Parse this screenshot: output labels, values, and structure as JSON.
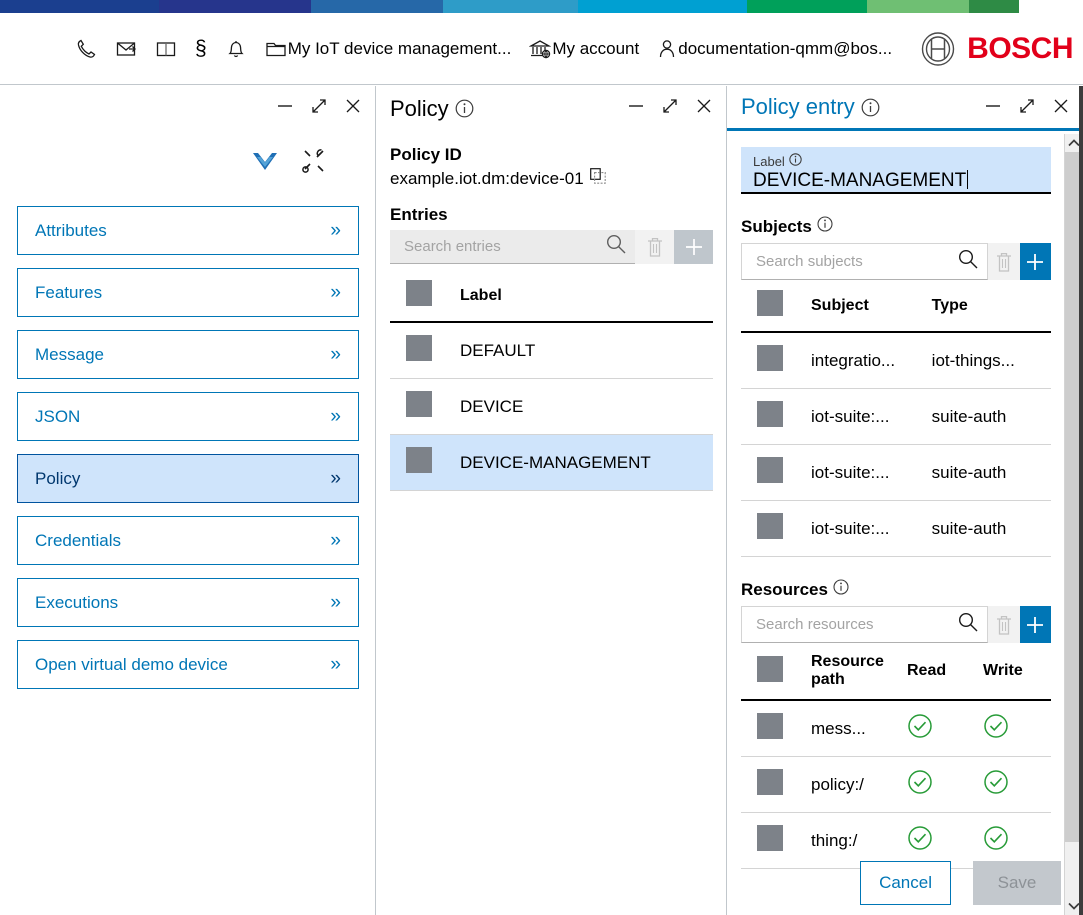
{
  "supergraphic": {
    "colors": [
      "#1b3f8f",
      "#26358c",
      "#2668a8",
      "#2e9cc8",
      "#00a0d2",
      "#00a05a",
      "#6fbf73",
      "#2e8b45"
    ]
  },
  "header": {
    "items": [
      {
        "icon": "phone-icon",
        "glyph": "✆",
        "label": ""
      },
      {
        "icon": "mail-icon",
        "glyph": "✉",
        "label": ""
      },
      {
        "icon": "book-icon",
        "glyph": "ὖE",
        "label": ""
      },
      {
        "icon": "section-sign-icon",
        "glyph": "§",
        "label": ""
      },
      {
        "icon": "bell-icon",
        "glyph": "ὑ4",
        "label": ""
      },
      {
        "icon": "folder-icon",
        "glyph": "folder",
        "label": "My IoT device management..."
      },
      {
        "icon": "bank-icon",
        "glyph": "bank",
        "label": "My account"
      },
      {
        "icon": "person-icon",
        "glyph": "person",
        "label": "documentation-qmm@bos..."
      }
    ],
    "logo": {
      "name": "bosch-logo",
      "wordmark": "BOSCH",
      "color": "#e2001a"
    }
  },
  "left_panel": {
    "window_controls": [
      "minimize",
      "expand",
      "close"
    ],
    "tool_icons": [
      {
        "name": "connected-heart-icon"
      },
      {
        "name": "tools-icon"
      }
    ],
    "nav_items": [
      {
        "label": "Attributes",
        "selected": false
      },
      {
        "label": "Features",
        "selected": false
      },
      {
        "label": "Message",
        "selected": false
      },
      {
        "label": "JSON",
        "selected": false
      },
      {
        "label": "Policy",
        "selected": true
      },
      {
        "label": "Credentials",
        "selected": false
      },
      {
        "label": "Executions",
        "selected": false
      },
      {
        "label": "Open virtual demo device",
        "selected": false
      }
    ],
    "chevron": "»"
  },
  "mid_panel": {
    "title": "Policy",
    "policy_id_label": "Policy ID",
    "policy_id_value": "example.iot.dm:device-01",
    "copy_icon": "copy-icon",
    "entries_label": "Entries",
    "search": {
      "placeholder": "Search entries",
      "value": ""
    },
    "toolbar": {
      "delete_icon": "trash-icon",
      "add_icon": "plus-icon"
    },
    "table": {
      "columns": [
        "",
        "Label"
      ],
      "rows": [
        {
          "label": "DEFAULT",
          "selected": false
        },
        {
          "label": "DEVICE",
          "selected": false
        },
        {
          "label": "DEVICE-MANAGEMENT",
          "selected": true
        }
      ]
    }
  },
  "right_panel": {
    "title": "Policy entry",
    "label_field": {
      "caption": "Label",
      "value": "DEVICE-MANAGEMENT"
    },
    "subjects": {
      "title": "Subjects",
      "search": {
        "placeholder": "Search subjects",
        "value": ""
      },
      "columns": [
        "",
        "Subject",
        "Type"
      ],
      "rows": [
        {
          "subject": "integratio...",
          "type": "iot-things..."
        },
        {
          "subject": "iot-suite:...",
          "type": "suite-auth"
        },
        {
          "subject": "iot-suite:...",
          "type": "suite-auth"
        },
        {
          "subject": "iot-suite:...",
          "type": "suite-auth"
        }
      ]
    },
    "resources": {
      "title": "Resources",
      "search": {
        "placeholder": "Search resources",
        "value": ""
      },
      "columns": [
        "",
        "Resource path",
        "Read",
        "Write"
      ],
      "rows": [
        {
          "path": "mess...",
          "read": true,
          "write": true
        },
        {
          "path": "policy:/",
          "read": true,
          "write": true
        },
        {
          "path": "thing:/",
          "read": true,
          "write": true
        }
      ]
    },
    "actions": {
      "cancel": "Cancel",
      "save": "Save",
      "save_disabled": true
    }
  },
  "colors": {
    "accent_blue": "#0076b6",
    "selection_blue": "#cfe4fb",
    "check_green": "#279b37",
    "bosch_red": "#e2001a",
    "checkbox_grey": "#7d8289"
  }
}
